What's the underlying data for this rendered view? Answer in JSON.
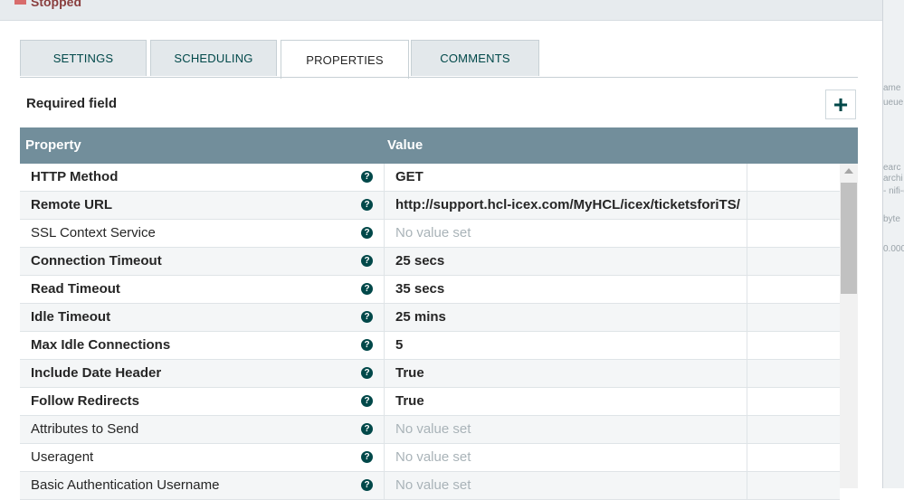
{
  "status": {
    "text": "Stopped",
    "color": "#d86c6c"
  },
  "background_fragments": [
    "ame",
    "ueue",
    "earc",
    "archi",
    "- nifi-e",
    "byte",
    "0.000"
  ],
  "tabs": [
    {
      "label": "SETTINGS",
      "active": false
    },
    {
      "label": "SCHEDULING",
      "active": false
    },
    {
      "label": "PROPERTIES",
      "active": true
    },
    {
      "label": "COMMENTS",
      "active": false
    }
  ],
  "required_label": "Required field",
  "add_button_symbol": "+",
  "table": {
    "headers": {
      "property": "Property",
      "value": "Value"
    },
    "help_symbol": "?",
    "rows": [
      {
        "name": "HTTP Method",
        "value": "GET",
        "required": true,
        "empty": false
      },
      {
        "name": "Remote URL",
        "value": "http://support.hcl-icex.com/MyHCL/icex/ticketsforiTS/",
        "required": true,
        "empty": false
      },
      {
        "name": "SSL Context Service",
        "value": "No value set",
        "required": false,
        "empty": true
      },
      {
        "name": "Connection Timeout",
        "value": "25 secs",
        "required": true,
        "empty": false
      },
      {
        "name": "Read Timeout",
        "value": "35 secs",
        "required": true,
        "empty": false
      },
      {
        "name": "Idle Timeout",
        "value": "25 mins",
        "required": true,
        "empty": false
      },
      {
        "name": "Max Idle Connections",
        "value": "5",
        "required": true,
        "empty": false
      },
      {
        "name": "Include Date Header",
        "value": "True",
        "required": true,
        "empty": false
      },
      {
        "name": "Follow Redirects",
        "value": "True",
        "required": true,
        "empty": false
      },
      {
        "name": "Attributes to Send",
        "value": "No value set",
        "required": false,
        "empty": true
      },
      {
        "name": "Useragent",
        "value": "No value set",
        "required": false,
        "empty": true
      },
      {
        "name": "Basic Authentication Username",
        "value": "No value set",
        "required": false,
        "empty": true
      }
    ]
  },
  "colors": {
    "accent": "#004849",
    "header_bg": "#728e9b",
    "highlight": "#f7f700",
    "placeholder": "#a9b3b8"
  }
}
